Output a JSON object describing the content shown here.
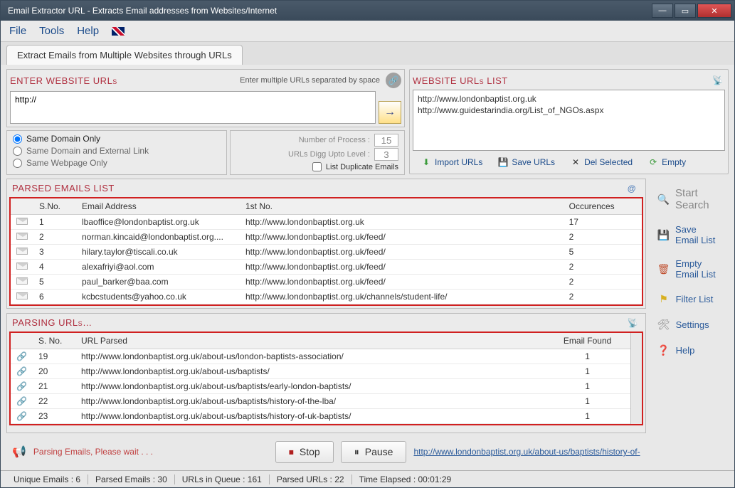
{
  "window": {
    "title": "Email Extractor URL - Extracts Email addresses from Websites/Internet"
  },
  "menu": {
    "file": "File",
    "tools": "Tools",
    "help": "Help"
  },
  "tab": {
    "label": "Extract Emails from Multiple Websites through URLs"
  },
  "enter_panel": {
    "title": "ENTER WEBSITE URLs",
    "hint": "Enter multiple URLs separated by space",
    "url_value": "http://"
  },
  "options": {
    "same_domain": "Same Domain Only",
    "same_ext": "Same Domain and External Link",
    "same_page": "Same Webpage Only",
    "num_process_label": "Number of Process :",
    "num_process_value": "15",
    "digg_label": "URLs Digg Upto Level :",
    "digg_value": "3",
    "dup_label": "List Duplicate Emails"
  },
  "url_list_panel": {
    "title": "WEBSITE URLs LIST",
    "items": [
      "http://www.londonbaptist.org.uk",
      "http://www.guidestarindia.org/List_of_NGOs.aspx"
    ]
  },
  "url_toolbar": {
    "import": "Import URLs",
    "save": "Save URLs",
    "del": "Del Selected",
    "empty": "Empty"
  },
  "emails_panel": {
    "title": "PARSED EMAILS LIST",
    "cols": {
      "sno": "S.No.",
      "email": "Email Address",
      "first": "1st No.",
      "occ": "Occurences"
    },
    "rows": [
      {
        "n": "1",
        "email": "lbaoffice@londonbaptist.org.uk",
        "first": "http://www.londonbaptist.org.uk",
        "occ": "17"
      },
      {
        "n": "2",
        "email": "norman.kincaid@londonbaptist.org....",
        "first": "http://www.londonbaptist.org.uk/feed/",
        "occ": "2"
      },
      {
        "n": "3",
        "email": "hilary.taylor@tiscali.co.uk",
        "first": "http://www.londonbaptist.org.uk/feed/",
        "occ": "5"
      },
      {
        "n": "4",
        "email": "alexafriyi@aol.com",
        "first": "http://www.londonbaptist.org.uk/feed/",
        "occ": "2"
      },
      {
        "n": "5",
        "email": "paul_barker@baa.com",
        "first": "http://www.londonbaptist.org.uk/feed/",
        "occ": "2"
      },
      {
        "n": "6",
        "email": "kcbcstudents@yahoo.co.uk",
        "first": "http://www.londonbaptist.org.uk/channels/student-life/",
        "occ": "2"
      }
    ]
  },
  "parsing_panel": {
    "title": "PARSING URLs…",
    "cols": {
      "sno": "S. No.",
      "url": "URL Parsed",
      "found": "Email Found"
    },
    "rows": [
      {
        "n": "19",
        "url": "http://www.londonbaptist.org.uk/about-us/london-baptists-association/",
        "found": "1"
      },
      {
        "n": "20",
        "url": "http://www.londonbaptist.org.uk/about-us/baptists/",
        "found": "1"
      },
      {
        "n": "21",
        "url": "http://www.londonbaptist.org.uk/about-us/baptists/early-london-baptists/",
        "found": "1"
      },
      {
        "n": "22",
        "url": "http://www.londonbaptist.org.uk/about-us/baptists/history-of-the-lba/",
        "found": "1"
      },
      {
        "n": "23",
        "url": "http://www.londonbaptist.org.uk/about-us/baptists/history-of-uk-baptists/",
        "found": "1"
      }
    ]
  },
  "side": {
    "start": "Start Search",
    "save": "Save Email List",
    "empty": "Empty Email List",
    "filter": "Filter List",
    "settings": "Settings",
    "help": "Help"
  },
  "bottom": {
    "status": "Parsing Emails, Please wait . . .",
    "stop": "Stop",
    "pause": "Pause",
    "url": "http://www.londonbaptist.org.uk/about-us/baptists/history-of-"
  },
  "statusbar": {
    "unique": "Unique Emails :  6",
    "parsed_emails": "Parsed Emails :   30",
    "queue": "URLs in Queue :   161",
    "parsed_urls": "Parsed URLs :   22",
    "elapsed": "Time Elapsed :   00:01:29"
  }
}
